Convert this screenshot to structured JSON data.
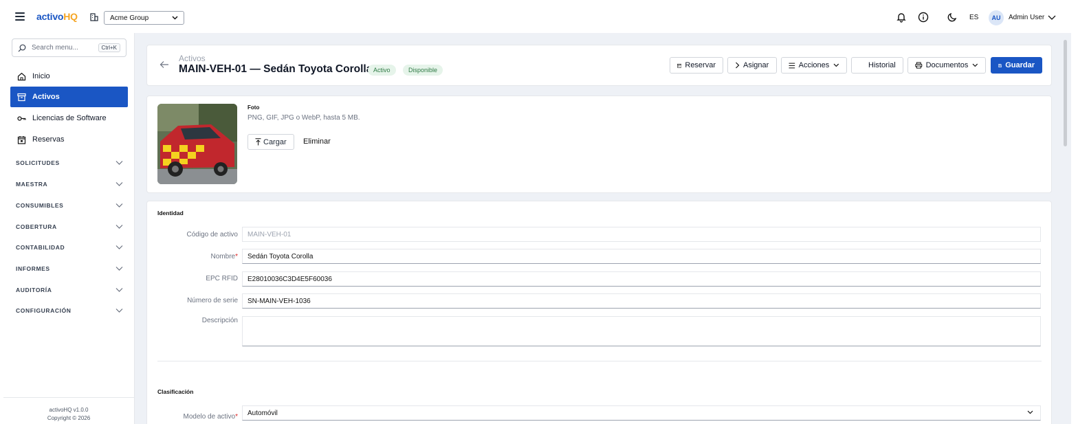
{
  "app": {
    "brand_part1": "activo",
    "brand_part2": "HQ",
    "org_selected": "Acme Group",
    "lang": "ES",
    "user_initials": "AU",
    "user_name": "Admin User"
  },
  "sidebar": {
    "search_placeholder": "Search menu...",
    "search_shortcut": "Ctrl+K",
    "items": [
      {
        "label": "Inicio",
        "icon": "home-icon"
      },
      {
        "label": "Activos",
        "icon": "archive-icon",
        "active": true
      },
      {
        "label": "Licencias de Software",
        "icon": "key-icon"
      },
      {
        "label": "Reservas",
        "icon": "calendar-icon"
      }
    ],
    "sections": [
      "SOLICITUDES",
      "MAESTRA",
      "CONSUMIBLES",
      "COBERTURA",
      "CONTABILIDAD",
      "INFORMES",
      "AUDITORÍA",
      "CONFIGURACIÓN"
    ],
    "footer_version": "activoHQ v1.0.0",
    "footer_copyright": "Copyright © 2026"
  },
  "header": {
    "breadcrumb": "Activos",
    "title": "MAIN-VEH-01 — Sedán Toyota Corolla",
    "badges": [
      "Activo",
      "Disponible"
    ],
    "buttons": {
      "reservar": "Reservar",
      "asignar": "Asignar",
      "acciones": "Acciones",
      "historial": "Historial",
      "documentos": "Documentos",
      "guardar": "Guardar"
    }
  },
  "photo": {
    "label": "Foto",
    "hint": "PNG, GIF, JPG o WebP, hasta 5 MB.",
    "upload": "Cargar",
    "delete": "Eliminar"
  },
  "identidad": {
    "title": "Identidad",
    "fields": [
      {
        "label": "Código de activo",
        "value": "MAIN-VEH-01",
        "required": false,
        "disabled": true
      },
      {
        "label": "Nombre",
        "value": "Sedán Toyota Corolla",
        "required": true
      },
      {
        "label": "EPC RFID",
        "value": "E28010036C3D4E5F60036",
        "required": false
      },
      {
        "label": "Número de serie",
        "value": "SN-MAIN-VEH-1036",
        "required": false
      },
      {
        "label": "Descripción",
        "value": "",
        "required": false
      }
    ]
  },
  "clasificacion": {
    "title": "Clasificación",
    "modelo_label": "Modelo de activo",
    "modelo_value": "Automóvil"
  },
  "colors": {
    "primary": "#1a56c4",
    "accent": "#f5a524",
    "badge_bg": "#e6f4ea",
    "badge_text": "#2f7a45",
    "required": "#dc2626"
  }
}
